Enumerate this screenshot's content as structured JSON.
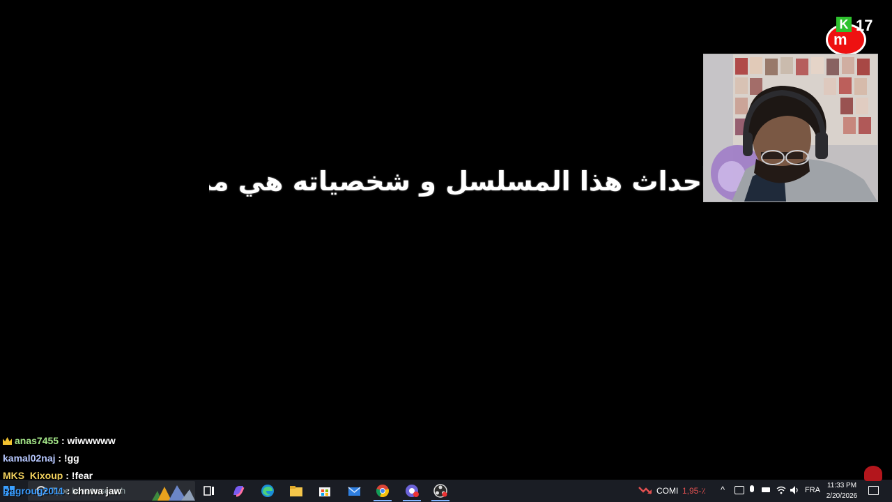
{
  "subtitle": {
    "text": "أحداث هذا المسلسل و شخصياته هي من"
  },
  "logo": {
    "letter_k": "K",
    "letters_mu": "m",
    "number": "17"
  },
  "chat": [
    {
      "user": "anas7455",
      "message": " : wiwwwww"
    },
    {
      "user": "kamal02naj",
      "message": " : !gg"
    },
    {
      "user": "MKS_Kixoup",
      "message": " : !fear"
    },
    {
      "user": "Ragroug2011",
      "message": " : chnwa jaw"
    }
  ],
  "taskbar": {
    "search_placeholder": "Type here to search",
    "apps": [
      "task-view",
      "copilot",
      "edge",
      "file-explorer",
      "microsoft-store",
      "mail",
      "chrome",
      "chrome-profile",
      "obs"
    ],
    "stock_ticker": "COMI",
    "stock_change": "1,95-٪",
    "language": "FRA",
    "time": "11:33 PM",
    "date": "2/20/2026"
  },
  "colors": {
    "background": "#000000",
    "taskbar": "#1a1d24",
    "logo_red": "#e11111",
    "logo_green": "#2ec12e",
    "stock_red": "#e05050"
  }
}
